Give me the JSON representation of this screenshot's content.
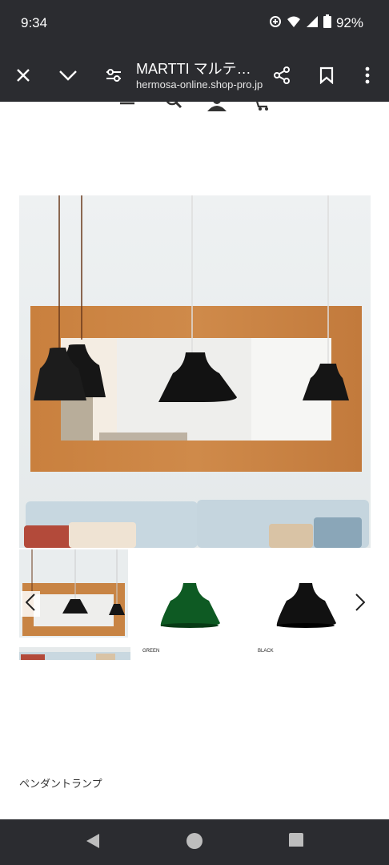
{
  "status_bar": {
    "time": "9:34",
    "battery": "92%"
  },
  "toolbar": {
    "title": "MARTTI マルテ…",
    "url": "hermosa-online.shop-pro.jp"
  },
  "gallery": {
    "swatches": [
      {
        "label": "GREEN",
        "color": "#0e5a23"
      },
      {
        "label": "BLACK",
        "color": "#111111"
      }
    ]
  },
  "product": {
    "caption": "ペンダントランプ"
  },
  "colors": {
    "chrome": "#2b2c30",
    "wood": "#c27a3c"
  }
}
